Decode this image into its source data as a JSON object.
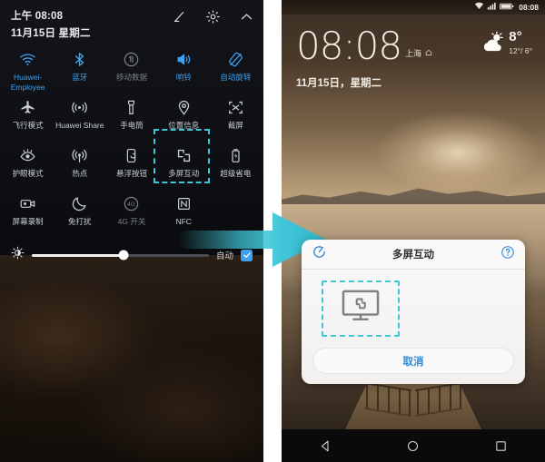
{
  "left_panel": {
    "status": {
      "time": "上午 08:08",
      "date": "11月15日 星期二"
    },
    "header_actions": [
      {
        "name": "edit-icon",
        "label": "编辑"
      },
      {
        "name": "settings-gear-icon",
        "label": "设置"
      },
      {
        "name": "chevron-up-icon",
        "label": "收起"
      }
    ],
    "quick_settings": [
      {
        "label": "Huawei-Employee",
        "icon": "wifi-icon",
        "state": "on"
      },
      {
        "label": "蓝牙",
        "icon": "bluetooth-icon",
        "state": "on"
      },
      {
        "label": "移动数据",
        "icon": "mobile-data-icon",
        "state": "off"
      },
      {
        "label": "响铃",
        "icon": "ringer-icon",
        "state": "on"
      },
      {
        "label": "自动旋转",
        "icon": "auto-rotate-icon",
        "state": "on"
      },
      {
        "label": "飞行模式",
        "icon": "airplane-icon",
        "state": "idle"
      },
      {
        "label": "Huawei Share",
        "icon": "huawei-share-icon",
        "state": "idle"
      },
      {
        "label": "手电筒",
        "icon": "flashlight-icon",
        "state": "idle"
      },
      {
        "label": "位置信息",
        "icon": "location-pin-icon",
        "state": "idle"
      },
      {
        "label": "截屏",
        "icon": "screenshot-icon",
        "state": "idle"
      },
      {
        "label": "护眼模式",
        "icon": "eye-comfort-icon",
        "state": "idle"
      },
      {
        "label": "热点",
        "icon": "hotspot-icon",
        "state": "idle"
      },
      {
        "label": "悬浮按钮",
        "icon": "floating-button-icon",
        "state": "idle"
      },
      {
        "label": "多屏互动",
        "icon": "multi-screen-cast-icon",
        "state": "idle"
      },
      {
        "label": "超级省电",
        "icon": "ultra-power-saving-icon",
        "state": "idle"
      },
      {
        "label": "屏幕录制",
        "icon": "screen-record-icon",
        "state": "idle"
      },
      {
        "label": "免打扰",
        "icon": "do-not-disturb-moon-icon",
        "state": "idle"
      },
      {
        "label": "4G 开关",
        "icon": "four-g-icon",
        "state": "off"
      },
      {
        "label": "NFC",
        "icon": "nfc-icon",
        "state": "idle"
      }
    ],
    "brightness": {
      "icon": "brightness-sun-icon",
      "value_percent": 52,
      "auto_label": "自动",
      "auto_checked": true
    }
  },
  "right_panel": {
    "status": {
      "time": "08:08",
      "icons": [
        "wifi-icon",
        "signal-icon",
        "battery-icon"
      ]
    },
    "lock_clock": {
      "time": "08:08",
      "city": "上海",
      "home_icon": "home-outline-icon",
      "date": "11月15日，星期二"
    },
    "weather": {
      "temp": "8°",
      "range": "12°/ 6°",
      "icon": "sun-behind-cloud-icon"
    },
    "dialog": {
      "title": "多屏互动",
      "refresh_icon": "refresh-scan-icon",
      "help_icon": "help-question-icon",
      "cast_icon": "monitor-cast-icon",
      "cancel_label": "取消"
    },
    "navbar": [
      {
        "name": "nav-back-icon",
        "label": "返回"
      },
      {
        "name": "nav-home-icon",
        "label": "主屏幕"
      },
      {
        "name": "nav-recents-icon",
        "label": "最近任务"
      }
    ]
  },
  "annotation": {
    "arrow_icon": "right-arrow-icon",
    "arrow_color": "#3fc6d8",
    "highlight_color": "#3fc6d8"
  }
}
